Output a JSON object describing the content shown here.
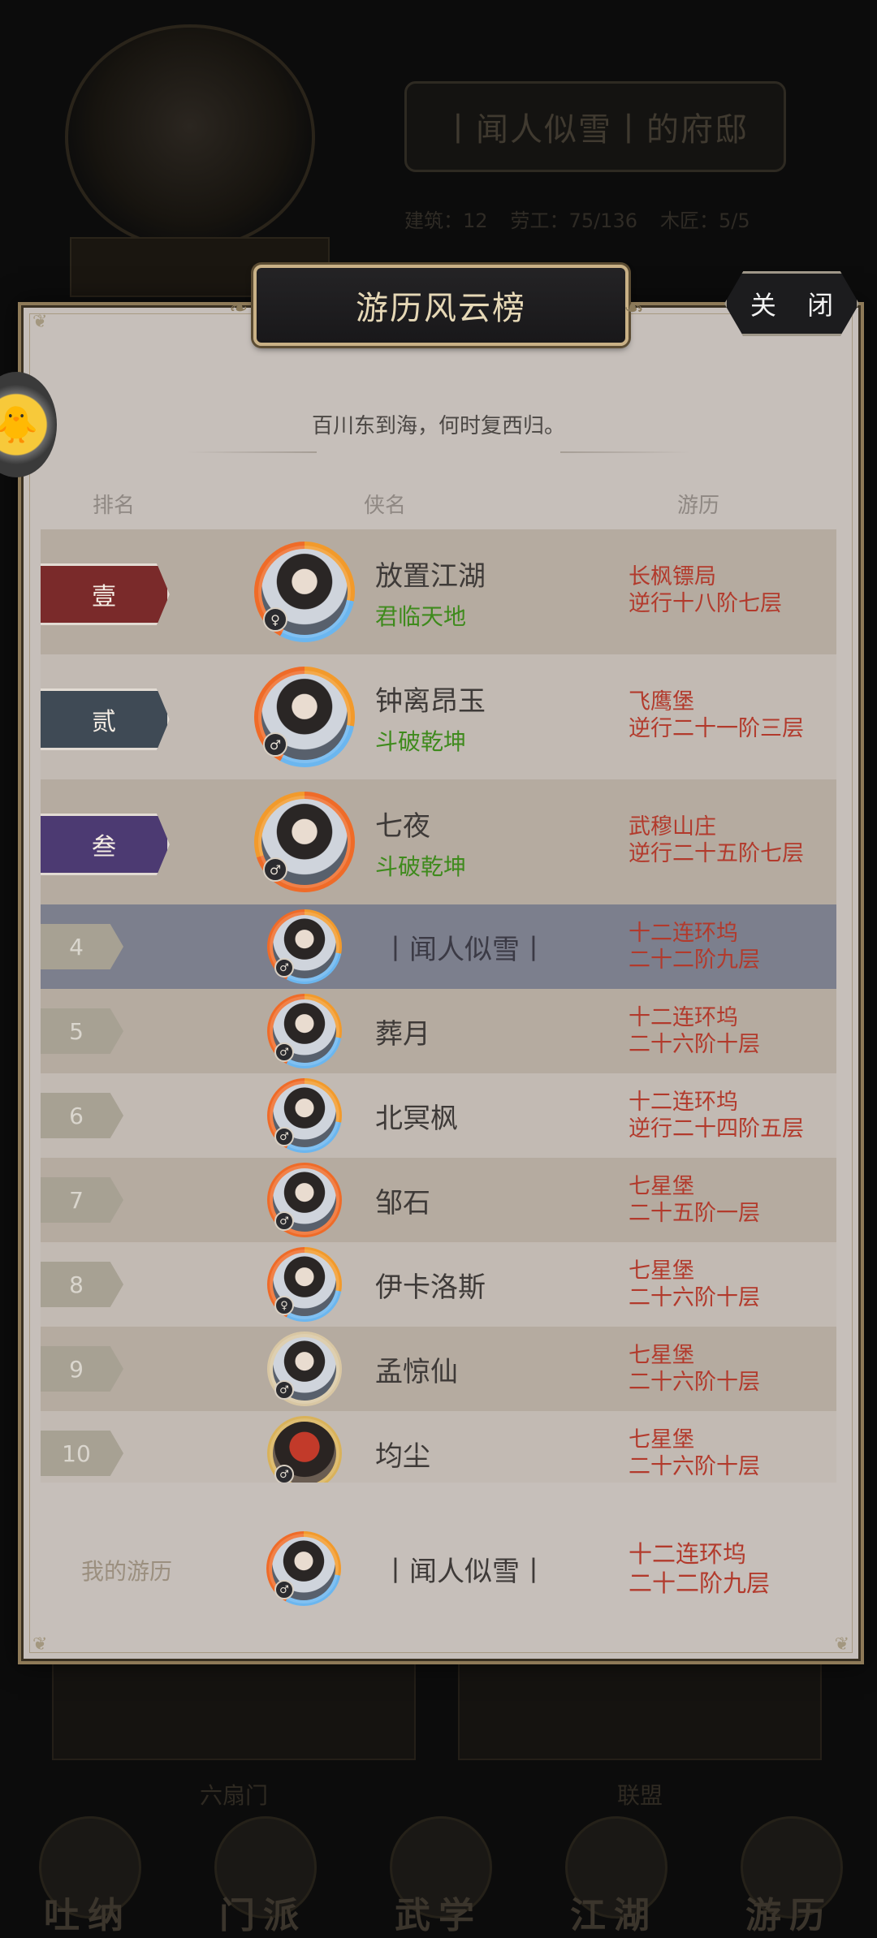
{
  "background": {
    "residence_title": "丨闻人似雪丨的府邸",
    "stats": [
      "建筑：12",
      "劳工：75/136",
      "木匠：5/5"
    ],
    "lower_labels": [
      "六扇门",
      "联盟"
    ],
    "nav": [
      "吐纳",
      "门派",
      "武学",
      "江湖",
      "游历"
    ]
  },
  "modal": {
    "title": "游历风云榜",
    "close_label": "关 闭",
    "quote": "百川东到海，何时复西归。",
    "columns": {
      "rank": "排名",
      "hero": "侠名",
      "travel": "游历"
    }
  },
  "rows": [
    {
      "rank": "壹",
      "name": "放置江湖",
      "title": "君临天地",
      "guild": "长枫镖局",
      "progress": "逆行十八阶七层",
      "color": "#7a2a2a"
    },
    {
      "rank": "贰",
      "name": "钟离昂玉",
      "title": "斗破乾坤",
      "guild": "飞鹰堡",
      "progress": "逆行二十一阶三层",
      "color": "#3f4a55"
    },
    {
      "rank": "叁",
      "name": "七夜",
      "title": "斗破乾坤",
      "guild": "武穆山庄",
      "progress": "逆行二十五阶七层",
      "color": "#4c3a72"
    },
    {
      "rank": "4",
      "name": "丨闻人似雪丨",
      "guild": "十二连环坞",
      "progress": "二十二阶九层"
    },
    {
      "rank": "5",
      "name": "葬月",
      "guild": "十二连环坞",
      "progress": "二十六阶十层"
    },
    {
      "rank": "6",
      "name": "北冥枫",
      "guild": "十二连环坞",
      "progress": "逆行二十四阶五层"
    },
    {
      "rank": "7",
      "name": "邹石",
      "guild": "七星堡",
      "progress": "二十五阶一层"
    },
    {
      "rank": "8",
      "name": "伊卡洛斯",
      "guild": "七星堡",
      "progress": "二十六阶十层"
    },
    {
      "rank": "9",
      "name": "孟惊仙",
      "guild": "七星堡",
      "progress": "二十六阶十层"
    },
    {
      "rank": "10",
      "name": "均尘",
      "guild": "七星堡",
      "progress": "二十六阶十层"
    }
  ],
  "my": {
    "label": "我的游历",
    "name": "丨闻人似雪丨",
    "guild": "十二连环坞",
    "progress": "二十二阶九层"
  },
  "icons": {
    "male": "♂",
    "female": "♀"
  }
}
